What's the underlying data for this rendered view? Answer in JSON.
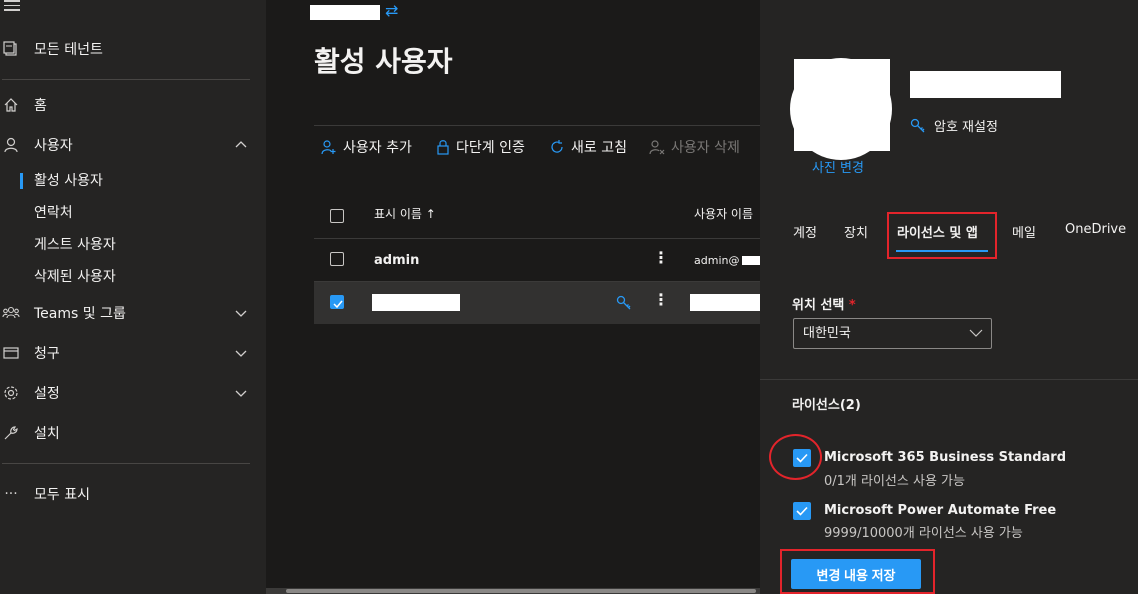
{
  "sidebar": {
    "all_tenants": "모든 테넌트",
    "home": "홈",
    "users": "사용자",
    "users_sub": [
      "활성 사용자",
      "연락처",
      "게스트 사용자",
      "삭제된 사용자"
    ],
    "teams": "Teams 및 그룹",
    "billing": "청구",
    "settings": "설정",
    "setup": "설치",
    "show_all": "모두 표시"
  },
  "main": {
    "title": "활성 사용자",
    "commands": {
      "add_user": "사용자 추가",
      "mfa": "다단계 인증",
      "refresh": "새로 고침",
      "delete_user": "사용자 삭제"
    },
    "table": {
      "col_display": "표시 이름 ↑",
      "col_username": "사용자 이름",
      "rows": [
        {
          "display": "admin",
          "username": "admin@"
        }
      ]
    }
  },
  "panel": {
    "change_photo": "사진 변경",
    "reset_password": "암호 재설정",
    "tabs": [
      "계정",
      "장치",
      "라이선스 및 앱",
      "메일",
      "OneDrive"
    ],
    "location_label": "위치 선택",
    "required_mark": "*",
    "location_value": "대한민국",
    "licenses_title": "라이선스(2)",
    "licenses": [
      {
        "name": "Microsoft 365 Business Standard",
        "availability": "0/1개 라이선스 사용 가능",
        "checked": true
      },
      {
        "name": "Microsoft Power Automate Free",
        "availability": "9999/10000개 라이선스 사용 가능",
        "checked": true
      }
    ],
    "save_label": "변경 내용 저장"
  },
  "colors": {
    "accent": "#2899f5",
    "highlight": "#e3242b",
    "background": "#1b1a19",
    "panel": "#252423"
  }
}
